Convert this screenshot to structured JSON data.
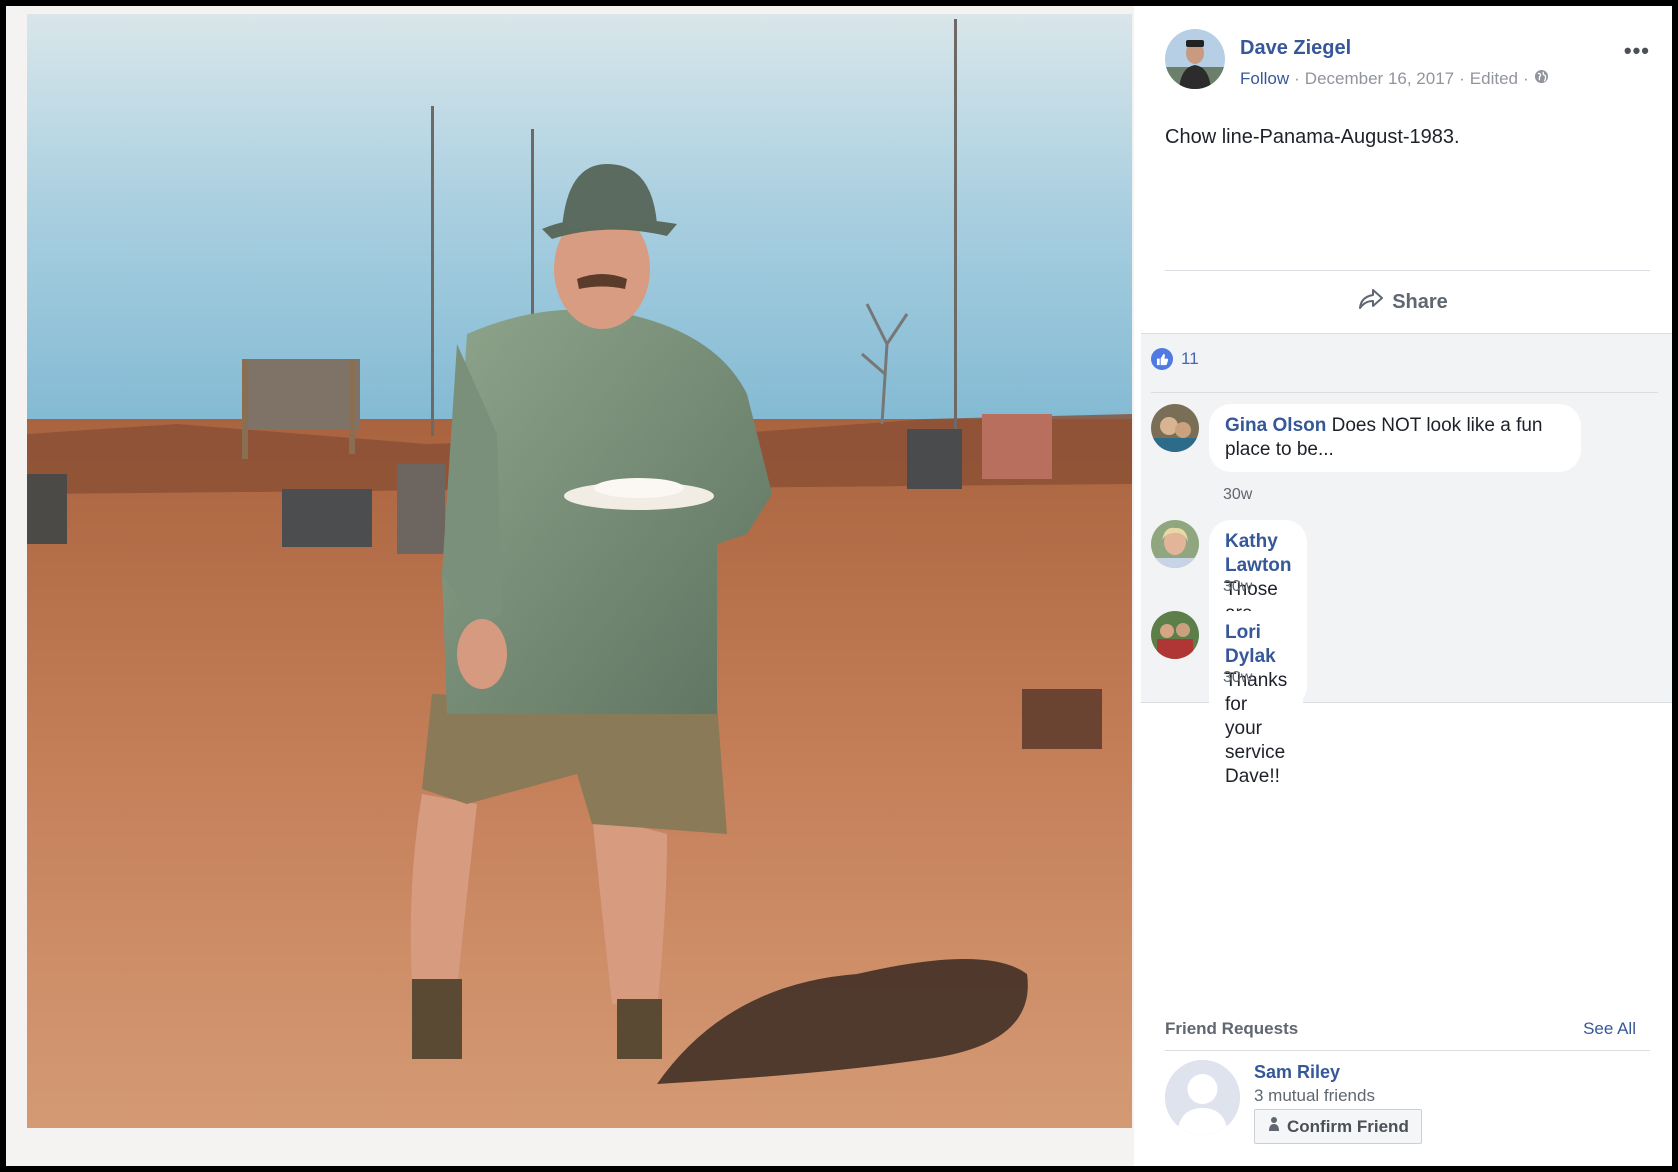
{
  "post": {
    "author_name": "Dave Ziegel",
    "follow_label": "Follow",
    "separator": "·",
    "date": "December 16, 2017",
    "edited_label": "Edited",
    "privacy_icon": "globe-icon",
    "more_label": "•••",
    "text": "Chow line-Panama-August-1983.",
    "share_label": "Share"
  },
  "reactions": {
    "icon": "like-icon",
    "count": "11"
  },
  "comments": [
    {
      "name": "Gina Olson",
      "text": "Does NOT look like a fun place to be...",
      "time": "30w"
    },
    {
      "name": "Kathy Lawton",
      "text": "Those are some sexy legs",
      "time": "30w"
    },
    {
      "name": "Lori Dylak",
      "text": "Thanks for your service Dave!!",
      "time": "30w"
    }
  ],
  "friend_requests": {
    "title": "Friend Requests",
    "see_all_label": "See All",
    "items": [
      {
        "name": "Sam Riley",
        "mutual": "3 mutual friends",
        "confirm_label": "Confirm Friend"
      }
    ]
  },
  "colors": {
    "link": "#365899",
    "meta": "#90949c",
    "comment_bg": "#f2f3f5",
    "like_blue": "#4f7ae2"
  }
}
